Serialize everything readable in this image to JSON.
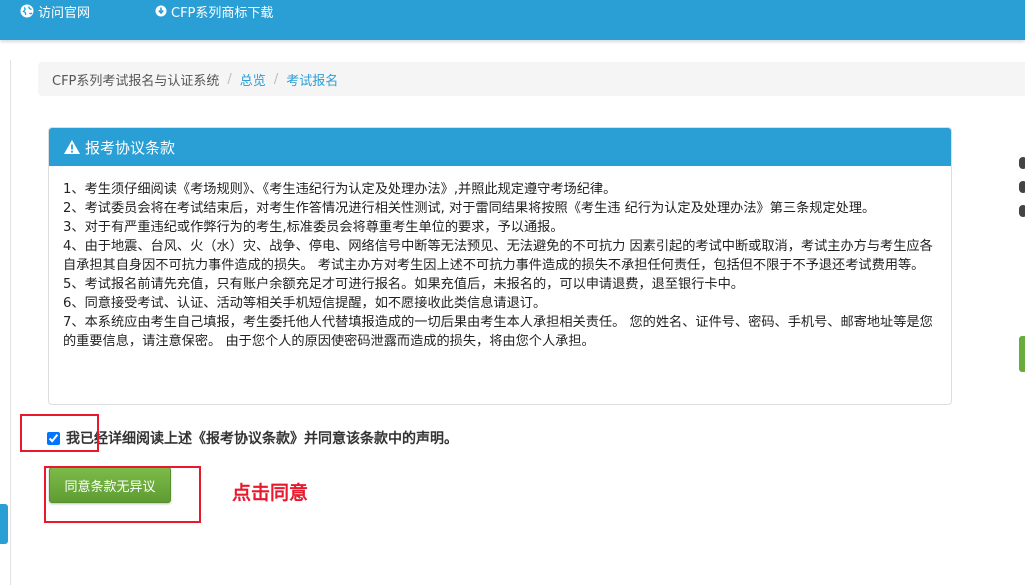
{
  "nav": {
    "visit_site": "访问官网",
    "download_logo": "CFP系列商标下载"
  },
  "breadcrumb": {
    "home": "CFP系列考试报名与认证系统",
    "overview": "总览",
    "current": "考试报名"
  },
  "panel": {
    "title": "报考协议条款",
    "terms": [
      "1、考生须仔细阅读《考场规则》、《考生违纪行为认定及处理办法》,并照此规定遵守考场纪律。",
      "2、考试委员会将在考试结束后，对考生作答情况进行相关性测试, 对于雷同结果将按照《考生违 纪行为认定及处理办法》第三条规定处理。",
      "3、对于有严重违纪或作弊行为的考生,标准委员会将尊重考生单位的要求，予以通报。",
      "4、由于地震、台风、火（水）灾、战争、停电、网络信号中断等无法预见、无法避免的不可抗力 因素引起的考试中断或取消，考试主办方与考生应各自承担其自身因不可抗力事件造成的损失。 考试主办方对考生因上述不可抗力事件造成的损失不承担任何责任，包括但不限于不予退还考试费用等。",
      "5、考试报名前请先充值，只有账户余额充足才可进行报名。如果充值后，未报名的，可以申请退费，退至银行卡中。",
      "6、同意接受考试、认证、活动等相关手机短信提醒，如不愿接收此类信息请退订。",
      "7、本系统应由考生自己填报，考生委托他人代替填报造成的一切后果由考生本人承担相关责任。 您的姓名、证件号、密码、手机号、邮寄地址等是您的重要信息，请注意保密。 由于您个人的原因使密码泄露而造成的损失，将由您个人承担。"
    ]
  },
  "agree": {
    "checkbox_label": "我已经详细阅读上述《报考协议条款》并同意该条款中的声明。",
    "checked": true,
    "button_label": "同意条款无异议"
  },
  "annotation": {
    "text": "点击同意",
    "color": "#e8192c"
  },
  "colors": {
    "primary": "#2a9fd6",
    "success": "#6aab3d"
  },
  "icons": {
    "visit_site": "globe-icon",
    "download": "download-icon",
    "warning": "warning-icon"
  }
}
